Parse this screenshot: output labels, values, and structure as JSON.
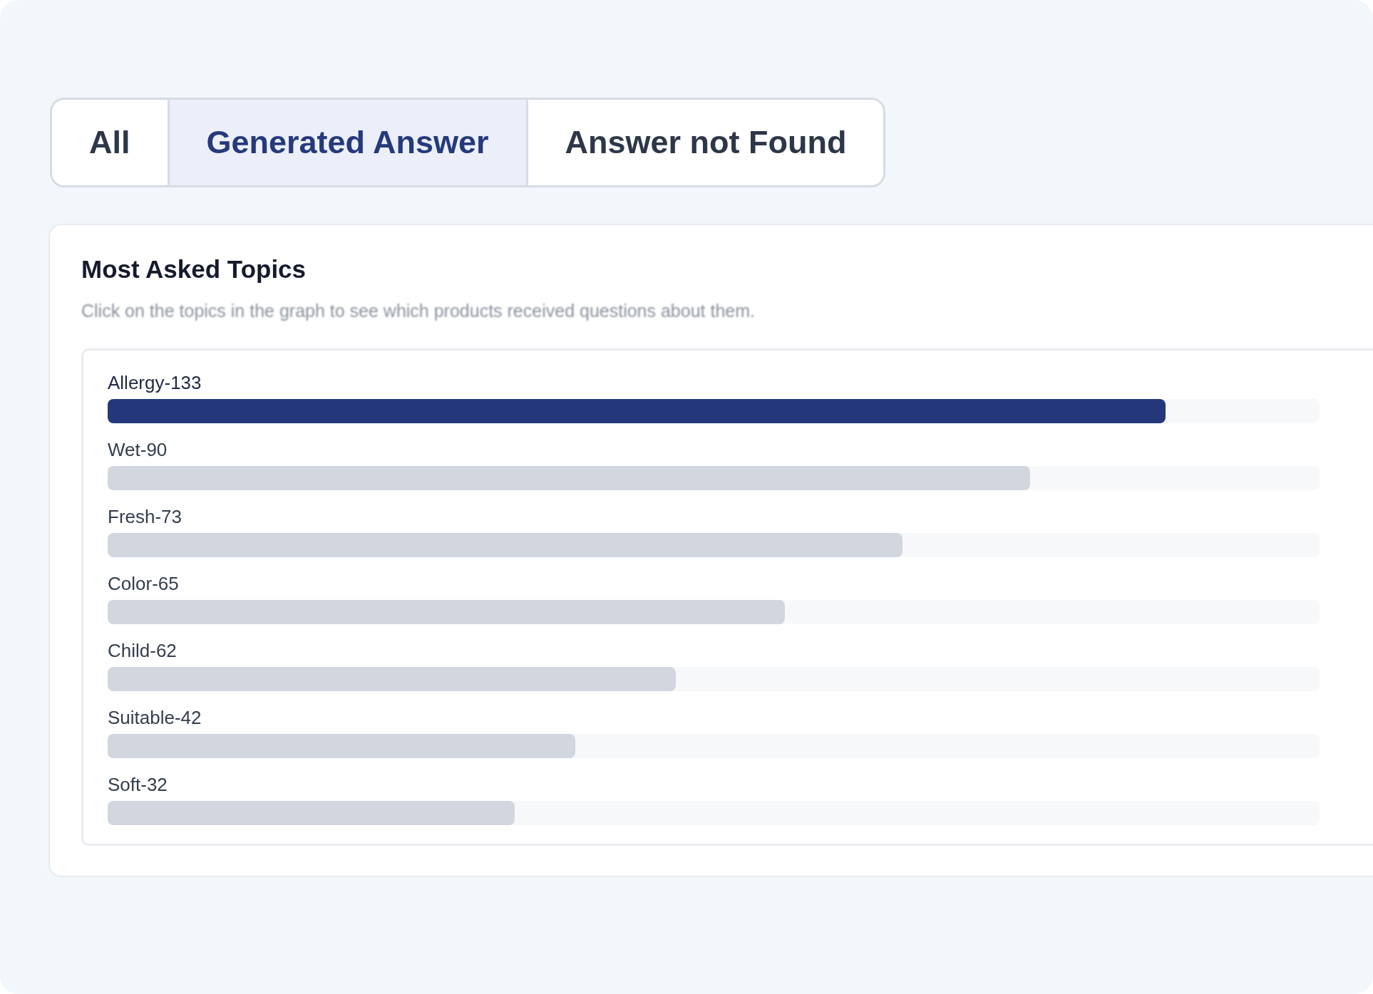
{
  "tabs": [
    {
      "label": "All",
      "selected": false
    },
    {
      "label": "Generated Answer",
      "selected": true
    },
    {
      "label": "Answer not Found",
      "selected": false
    }
  ],
  "card": {
    "title": "Most Asked Topics",
    "subtitle": "Click on the topics in the graph to see which products received questions about them.",
    "topics": [
      {
        "label": "Allergy-133",
        "level": 0.873,
        "selected": true
      },
      {
        "label": "Wet-90",
        "level": 0.761,
        "selected": false
      },
      {
        "label": "Fresh-73",
        "level": 0.656,
        "selected": false
      },
      {
        "label": "Color-65",
        "level": 0.559,
        "selected": false
      },
      {
        "label": "Child-62",
        "level": 0.469,
        "selected": false
      },
      {
        "label": "Suitable-42",
        "level": 0.386,
        "selected": false
      },
      {
        "label": "Soft-32",
        "level": 0.336,
        "selected": false
      }
    ]
  }
}
